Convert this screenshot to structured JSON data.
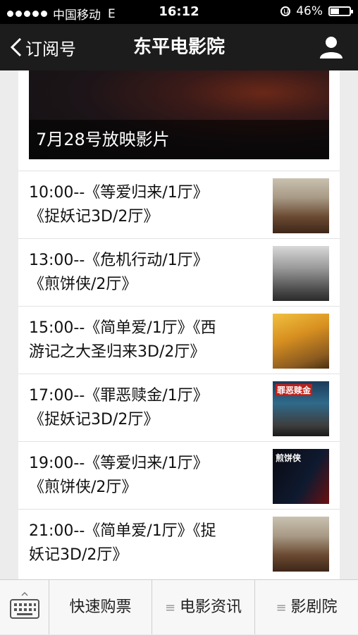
{
  "status_bar": {
    "carrier": "中国移动",
    "network": "E",
    "time": "16:12",
    "battery": "46%",
    "battery_level": 0.46
  },
  "nav": {
    "back_label": "订阅号",
    "title": "东平电影院"
  },
  "banner": {
    "caption": "7月28号放映影片"
  },
  "schedule": [
    {
      "line1": "10:00--《等爱归来/1厅》",
      "line2": "《捉妖记3D/2厅》"
    },
    {
      "line1": "13:00--《危机行动/1厅》",
      "line2": "《煎饼侠/2厅》"
    },
    {
      "line1": "15:00--《简单爱/1厅》《西",
      "line2": "游记之大圣归来3D/2厅》"
    },
    {
      "line1": "17:00--《罪恶赎金/1厅》",
      "line2": "《捉妖记3D/2厅》"
    },
    {
      "line1": "19:00--《等爱归来/1厅》",
      "line2": "《煎饼侠/2厅》"
    },
    {
      "line1": "21:00--《简单爱/1厅》《捉",
      "line2": "妖记3D/2厅》"
    }
  ],
  "posters": {
    "p4_label": "罪恶赎金",
    "p5_label": "煎饼侠"
  },
  "bottom_menu": {
    "items": [
      "快速购票",
      "电影资讯",
      "影剧院"
    ]
  },
  "colors": {
    "nav_bg": "#1c1c1c",
    "page_bg": "#ececec"
  }
}
